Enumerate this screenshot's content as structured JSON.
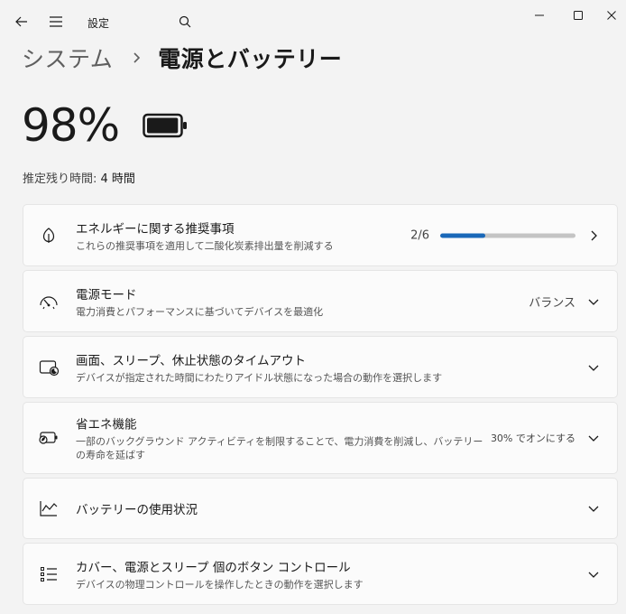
{
  "titlebar": {
    "app_title": "設定",
    "icons": [
      "back-arrow-icon",
      "hamburger-menu-icon",
      "search-icon",
      "minimize-icon",
      "maximize-icon",
      "close-icon"
    ]
  },
  "breadcrumb": {
    "parent": "システム",
    "current": "電源とバッテリー"
  },
  "battery": {
    "percent": "98%",
    "level": 0.98,
    "estimate_label": "推定残り時間:",
    "estimate_value": "4 時間"
  },
  "accent_color": "#1a68b8",
  "cards": [
    {
      "icon": "leaf-icon",
      "title": "エネルギーに関する推奨事項",
      "subtitle": "これらの推奨事項を適用して二酸化炭素排出量を削減する",
      "progress_text": "2/6",
      "progress_value": 2,
      "progress_max": 6,
      "chevron": "chevron-right-icon"
    },
    {
      "icon": "gauge-icon",
      "title": "電源モード",
      "subtitle": "電力消費とパフォーマンスに基づいてデバイスを最適化",
      "value": "バランス",
      "chevron": "chevron-down-icon"
    },
    {
      "icon": "screen-sleep-icon",
      "title": "画面、スリープ、休止状態のタイムアウト",
      "subtitle": "デバイスが指定された時間にわたりアイドル状態になった場合の動作を選択します",
      "chevron": "chevron-down-icon"
    },
    {
      "icon": "battery-saver-icon",
      "title": "省エネ機能",
      "subtitle": "一部のバックグラウンド アクティビティを制限することで、電力消費を削減し、バッテリーの寿命を延ばす",
      "value": "30% でオンにする",
      "chevron": "chevron-down-icon"
    },
    {
      "icon": "chart-line-icon",
      "title": "バッテリーの使用状況",
      "chevron": "chevron-down-icon"
    },
    {
      "icon": "list-icon",
      "title": "カバー、電源とスリープ 個のボタン コントロール",
      "subtitle": "デバイスの物理コントロールを操作したときの動作を選択します",
      "chevron": "chevron-down-icon"
    }
  ]
}
